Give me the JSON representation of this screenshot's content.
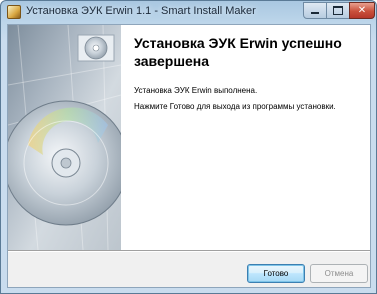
{
  "window": {
    "title": "Установка ЭУК Erwin 1.1 - Smart Install Maker"
  },
  "main": {
    "heading": "Установка ЭУК Erwin успешно завершена",
    "line1": "Установка ЭУК Erwin выполнена.",
    "line2": "Нажмите Готово для выхода из программы установки."
  },
  "buttons": {
    "finish": "Готово",
    "cancel": "Отмена"
  },
  "icons": {
    "app": "installer-icon",
    "side": "cd-disc-image"
  },
  "colors": {
    "titlebar": "#bdd6ea",
    "close_button": "#c9503b",
    "default_button_border": "#3c7fb1"
  }
}
